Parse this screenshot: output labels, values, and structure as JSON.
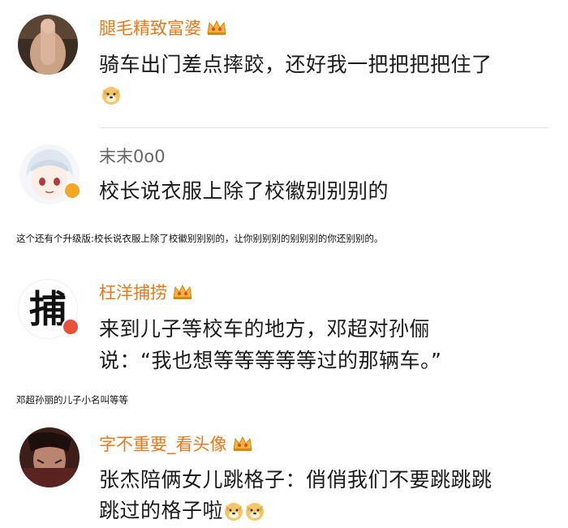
{
  "colors": {
    "vip_name": "#e9781f",
    "plain_name": "#666666",
    "text": "#1a1a1a",
    "divider": "#e6e6e6"
  },
  "comments": [
    {
      "username": "腿毛精致富婆",
      "icon": "vip-crown-icon",
      "text": "骑车出门差点摔跤，还好我一把把把把住了",
      "emojis": [
        "doge-emoji"
      ]
    },
    {
      "username": "末末0o0",
      "icon": "verified-badge-icon",
      "text": "校长说衣服上除了校徽别别别的"
    },
    {
      "username": "枉洋捕捞",
      "icon": "vip-crown-icon",
      "avatar_char": "捕",
      "text_line1": "来到儿子等校车的地方，邓超对孙俪",
      "text_line2": "说：“我也想等等等等等过的那辆车。”"
    },
    {
      "username": "字不重要_看头像",
      "icon": "vip-crown-icon",
      "text_line1": "张杰陪俩女儿跳格子：俏俏我们不要跳跳跳",
      "text_line2": "跳过的格子啦",
      "emojis": [
        "doge-emoji",
        "doge-emoji"
      ]
    }
  ],
  "captions": [
    "这个还有个升级版:校长说衣服上除了校徽别别别的，让你别别别的别别别的你还别别的。",
    "邓超孙丽的儿子小名叫等等"
  ]
}
